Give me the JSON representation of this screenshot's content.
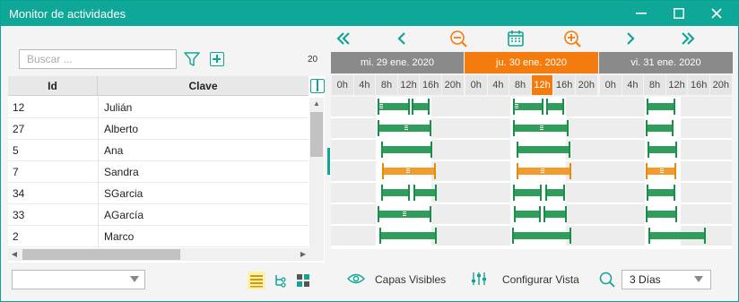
{
  "window": {
    "title": "Monitor de actividades",
    "accent": "#0fa797",
    "highlight": "#f47c0f"
  },
  "left": {
    "search_placeholder": "Buscar ...",
    "count": "20",
    "columns": {
      "id": "Id",
      "clave": "Clave"
    },
    "rows": [
      {
        "id": "12",
        "clave": "Julián"
      },
      {
        "id": "27",
        "clave": "Alberto"
      },
      {
        "id": "5",
        "clave": "Ana"
      },
      {
        "id": "7",
        "clave": "Sandra"
      },
      {
        "id": "34",
        "clave": "SGarcia"
      },
      {
        "id": "33",
        "clave": "AGarcía"
      },
      {
        "id": "2",
        "clave": "Marco"
      }
    ],
    "combo_value": ""
  },
  "timeline": {
    "days": [
      {
        "label": "mi. 29 ene. 2020",
        "active": false
      },
      {
        "label": "ju. 30 ene. 2020",
        "active": true
      },
      {
        "label": "vi. 31 ene. 2020",
        "active": false
      }
    ],
    "hours": [
      "0h",
      "4h",
      "8h",
      "12h",
      "16h",
      "20h"
    ],
    "active_hour": {
      "day": 1,
      "hour": "12h"
    }
  },
  "toolbar": {
    "layers_label": "Capas Visibles",
    "config_label": "Configurar Vista",
    "range_value": "3 Días"
  },
  "icons": {
    "nav": [
      "double-chevron-left-icon",
      "chevron-left-icon",
      "zoom-out-icon",
      "calendar-icon",
      "zoom-in-icon",
      "chevron-right-icon",
      "double-chevron-right-icon"
    ]
  }
}
